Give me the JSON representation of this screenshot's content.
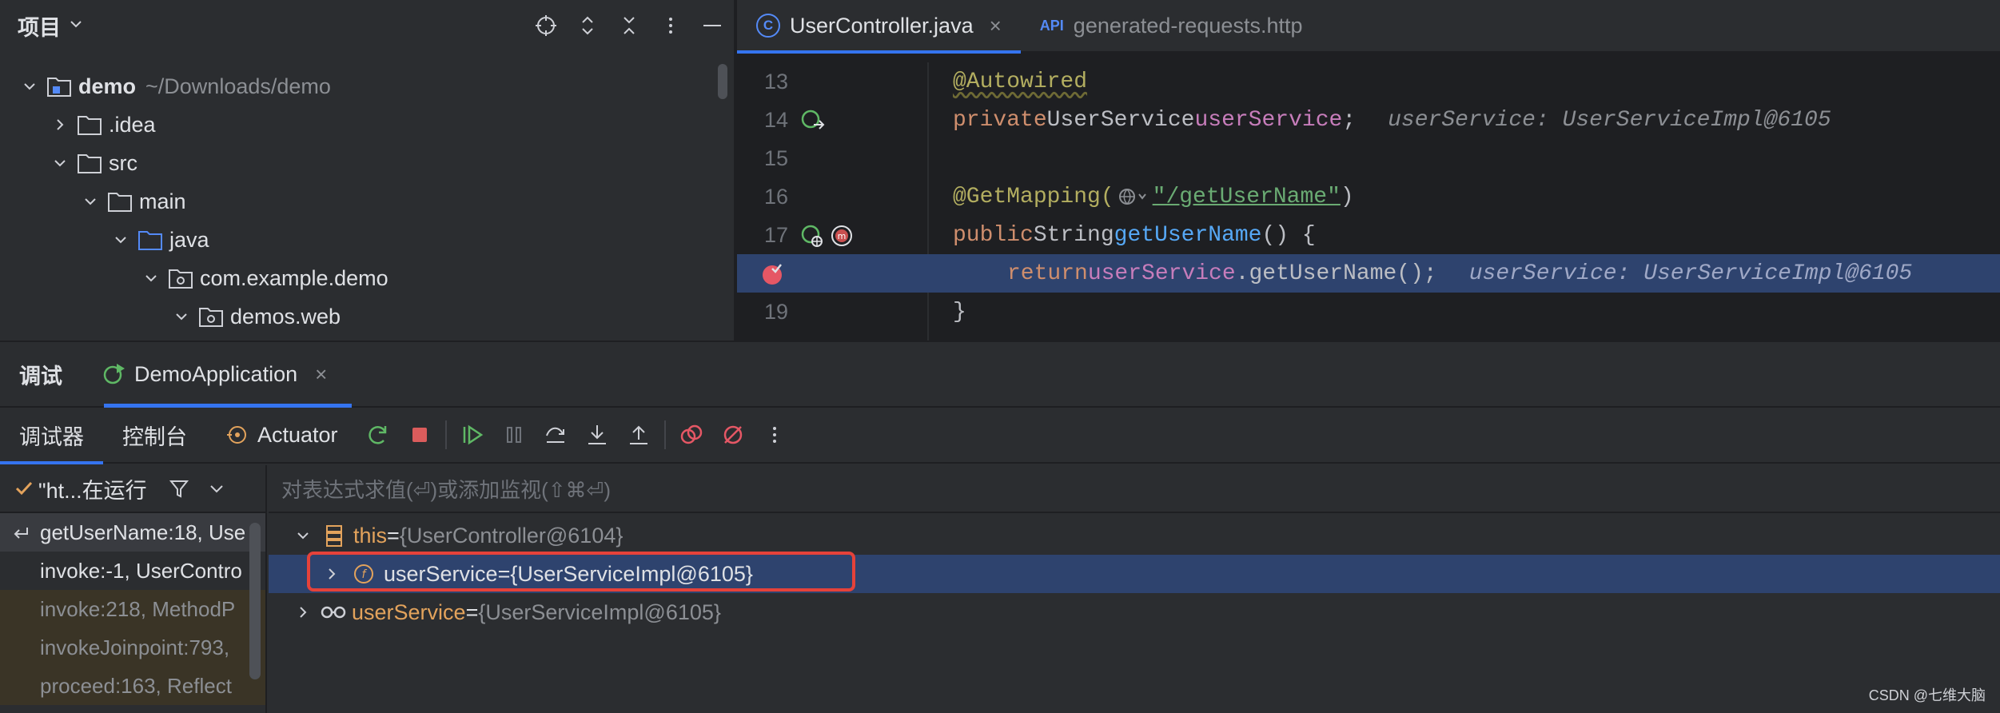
{
  "project": {
    "title": "项目",
    "tree": [
      {
        "name": "demo",
        "path": "~/Downloads/demo",
        "bold": true,
        "depth": 0,
        "expanded": true
      },
      {
        "name": ".idea",
        "depth": 1,
        "expanded": false
      },
      {
        "name": "src",
        "depth": 1,
        "expanded": true
      },
      {
        "name": "main",
        "depth": 2,
        "expanded": true
      },
      {
        "name": "java",
        "depth": 3,
        "expanded": true
      },
      {
        "name": "com.example.demo",
        "depth": 4,
        "expanded": true
      },
      {
        "name": "demos.web",
        "depth": 5,
        "expanded": true
      }
    ]
  },
  "editor": {
    "tabs": [
      {
        "label": "UserController.java",
        "icon": "C",
        "active": true
      },
      {
        "label": "generated-requests.http",
        "icon": "API",
        "active": false
      }
    ],
    "lines": [
      {
        "num": "13"
      },
      {
        "num": "14"
      },
      {
        "num": "15"
      },
      {
        "num": "16"
      },
      {
        "num": "17"
      },
      {
        "num": ""
      },
      {
        "num": "19"
      }
    ],
    "code": {
      "l13": "@Autowired",
      "l14_kw": "private",
      "l14_type": "UserService",
      "l14_field": "userService",
      "l14_semi": ";",
      "l14_inlay": "userService: UserServiceImpl@6105",
      "l16_annot": "@GetMapping(",
      "l16_str": "\"/getUserName\"",
      "l16_close": ")",
      "l17_kw": "public",
      "l17_type": "String",
      "l17_method": "getUserName",
      "l17_rest": "() {",
      "l18_kw": "return",
      "l18_field": "userService",
      "l18_rest": ".getUserName();",
      "l18_inlay": "userService: UserServiceImpl@6105",
      "l19": "}"
    }
  },
  "debug": {
    "title": "调试",
    "session": "DemoApplication",
    "tabs": [
      "调试器",
      "控制台",
      "Actuator"
    ],
    "thread": "\"ht...在运行",
    "eval_placeholder": "对表达式求值(⏎)或添加监视(⇧⌘⏎)",
    "frames": [
      {
        "label": "getUserName:18, Use",
        "style": "sel"
      },
      {
        "label": "invoke:-1, UserContro",
        "style": "norm"
      },
      {
        "label": "invoke:218, MethodP",
        "style": "dim"
      },
      {
        "label": "invokeJoinpoint:793,",
        "style": "dim"
      },
      {
        "label": "proceed:163, Reflect",
        "style": "dim"
      }
    ],
    "vars": {
      "this_name": "this",
      "this_val": "{UserController@6104}",
      "child_name": "userService",
      "child_val": "{UserServiceImpl@6105}",
      "watch_name": "userService",
      "watch_val": "{UserServiceImpl@6105}",
      "eq": " = "
    }
  },
  "watermark": "CSDN @七维大脑",
  "colors": {
    "accent": "#3574f0",
    "highlight": "#2e436e",
    "breakpoint": "#e55765",
    "redbox": "#e5423a"
  }
}
